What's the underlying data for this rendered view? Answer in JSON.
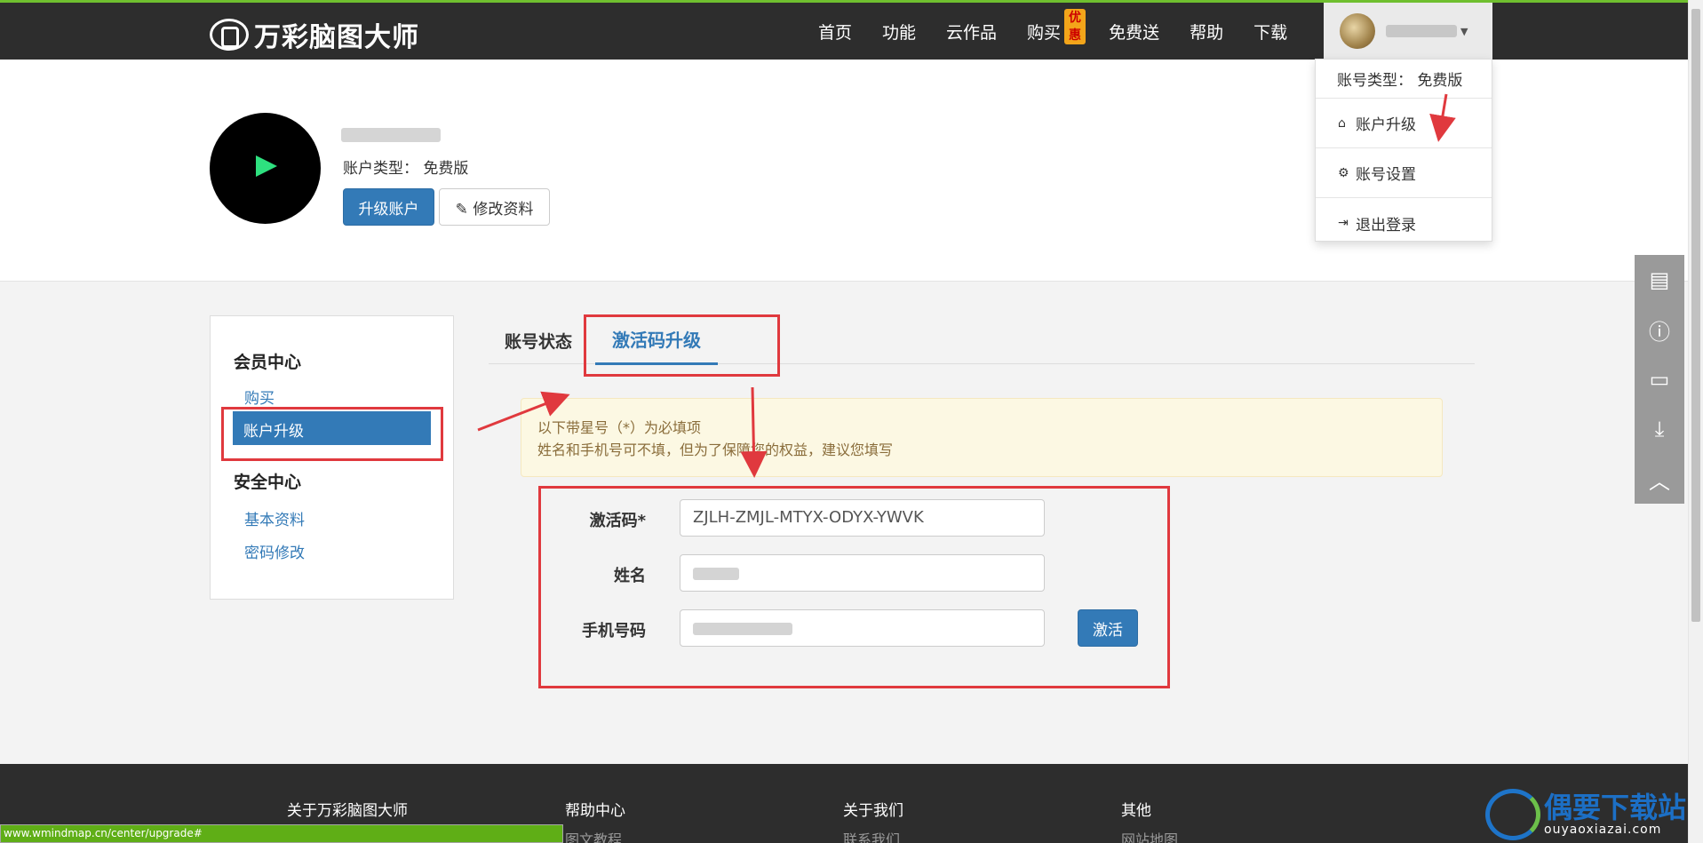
{
  "brand": {
    "name": "万彩脑图大师"
  },
  "nav": {
    "items": [
      "首页",
      "功能",
      "云作品",
      "购买",
      "免费送",
      "帮助",
      "下载"
    ],
    "badge": "优惠"
  },
  "dropdown": {
    "account_type": "账号类型： 免费版",
    "upgrade": "账户升级",
    "settings": "账号设置",
    "logout": "退出登录"
  },
  "profile": {
    "account_type": "账户类型： 免费版",
    "upgrade_button": "升级账户",
    "edit_button": "修改资料"
  },
  "sidebar": {
    "member_center": "会员中心",
    "buy": "购买",
    "upgrade": "账户升级",
    "security_center": "安全中心",
    "basic_info": "基本资料",
    "password": "密码修改"
  },
  "tabs": {
    "status": "账号状态",
    "code_upgrade": "激活码升级"
  },
  "notice": {
    "line1": "以下带星号（*）为必填项",
    "line2": "姓名和手机号可不填，但为了保障您的权益，建议您填写"
  },
  "form": {
    "code_label": "激活码*",
    "code_value": "ZJLH-ZMJL-MTYX-ODYX-YWVK",
    "name_label": "姓名",
    "phone_label": "手机号码",
    "activate_button": "激活"
  },
  "footer": {
    "about_app": "关于万彩脑图大师",
    "help_center": "帮助中心",
    "help_link": "图文教程",
    "about_us": "关于我们",
    "contact": "联系我们",
    "other": "其他",
    "sitemap": "网站地图"
  },
  "status_url": "www.wmindmap.cn/center/upgrade#",
  "watermark": {
    "title": "偶要下载站",
    "domain": "ouyaoxiazai.com"
  },
  "colors": {
    "primary": "#337ab7",
    "annotation": "#e0393e",
    "nav_bg": "#2d2d2d"
  }
}
